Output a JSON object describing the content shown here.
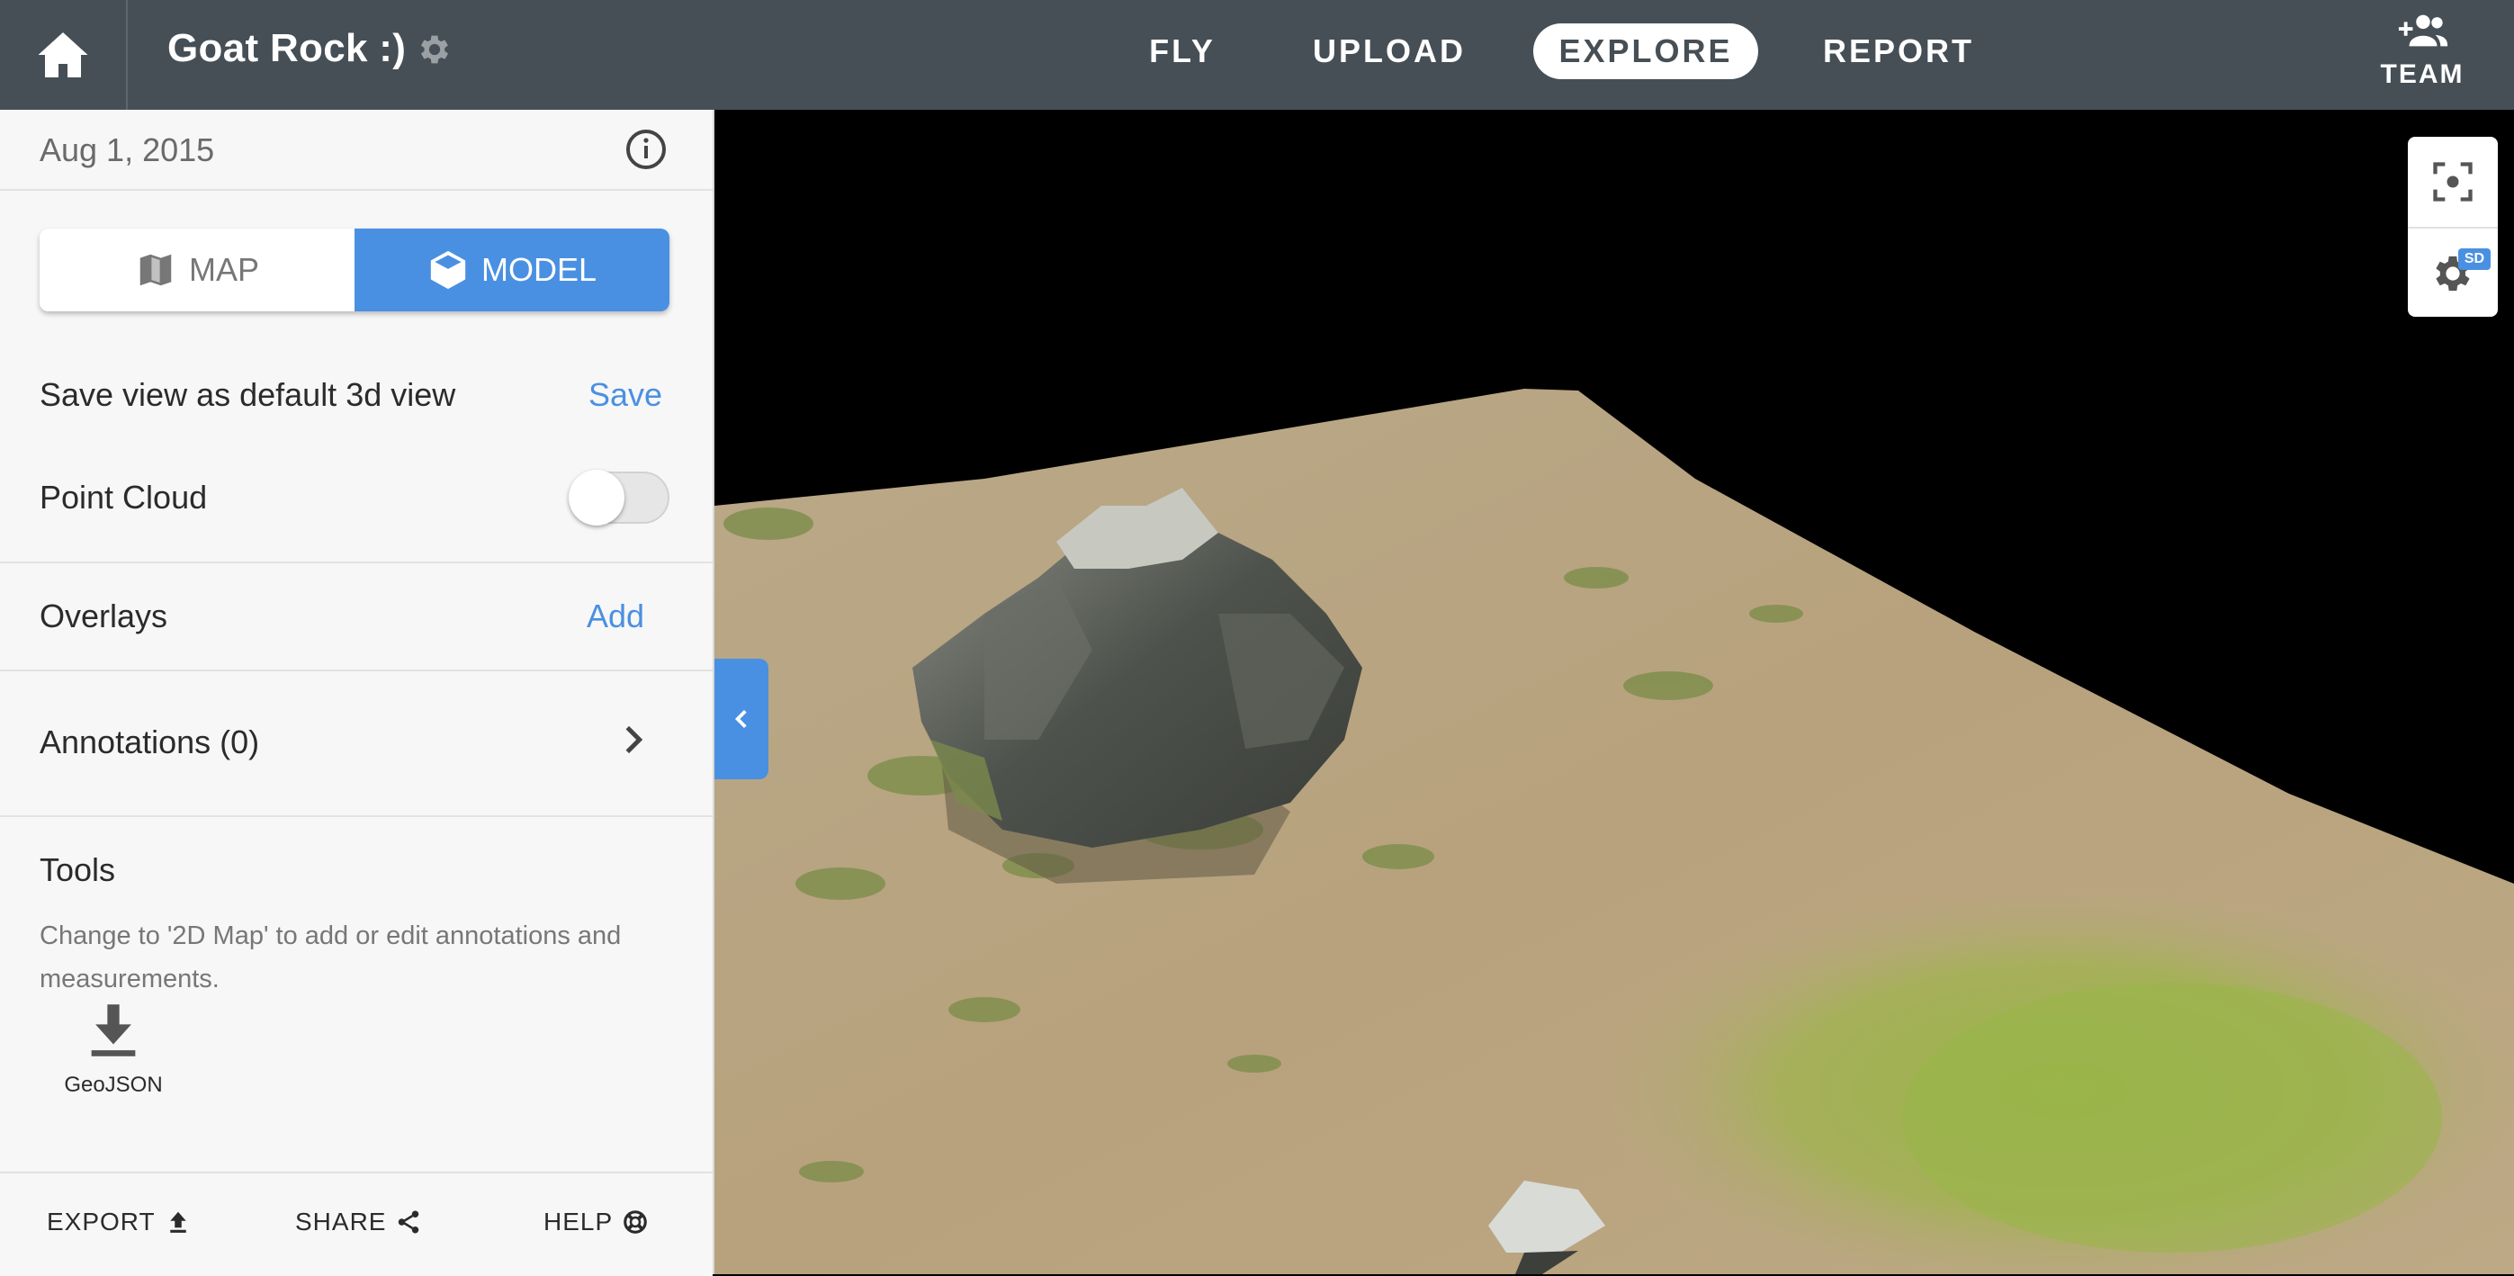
{
  "header": {
    "project_title": "Goat Rock :)",
    "nav": [
      {
        "label": "FLY",
        "active": false
      },
      {
        "label": "UPLOAD",
        "active": false
      },
      {
        "label": "EXPLORE",
        "active": true
      },
      {
        "label": "REPORT",
        "active": false
      }
    ],
    "team_label": "TEAM",
    "icons": {
      "home": "home-icon",
      "settings": "gear-icon",
      "team": "add-person-icon"
    }
  },
  "sidebar": {
    "date": "Aug 1, 2015",
    "view_toggle": {
      "options": [
        {
          "label": "MAP",
          "icon": "map-icon",
          "selected": false
        },
        {
          "label": "MODEL",
          "icon": "cube-icon",
          "selected": true
        }
      ]
    },
    "save_view": {
      "label": "Save view as default 3d view",
      "action": "Save"
    },
    "point_cloud": {
      "label": "Point Cloud",
      "enabled": false
    },
    "overlays": {
      "label": "Overlays",
      "action": "Add"
    },
    "annotations": {
      "label": "Annotations (0)"
    },
    "tools": {
      "title": "Tools",
      "description": "Change to '2D Map' to add or edit annotations and measurements.",
      "export_item": {
        "label": "GeoJSON",
        "icon": "download-icon"
      }
    },
    "footer": {
      "export": "EXPORT",
      "share": "SHARE",
      "help": "HELP"
    }
  },
  "viewport": {
    "tools": [
      {
        "icon": "recenter-icon"
      },
      {
        "icon": "gear-icon",
        "badge": "SD"
      }
    ]
  },
  "colors": {
    "topbar": "#464f56",
    "accent": "#4a90e2",
    "sidebar_bg": "#f7f7f7",
    "viewport_bg": "#000000"
  }
}
